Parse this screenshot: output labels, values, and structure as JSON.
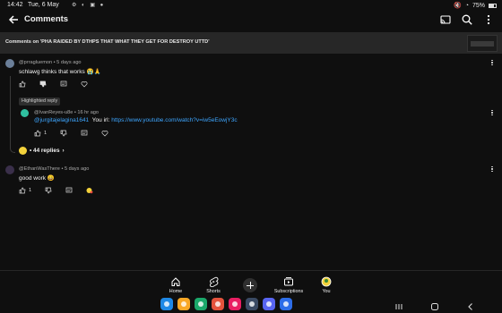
{
  "status_bar": {
    "time": "14:42",
    "date": "Tue, 6 May",
    "battery": "75%"
  },
  "app_bar": {
    "title": "Comments"
  },
  "context": {
    "text": "Comments on 'PHA RAIDED BY DTHPS THAT WHAT THEY GET FOR DESTROY UTTD'"
  },
  "comments": [
    {
      "author": "@prragluemon",
      "age": "5 days ago",
      "text": "schlawg thinks that works 😭🙏",
      "likes": ""
    },
    {
      "highlight_label": "Highlighted reply",
      "author": "@IvanReyes-u8e",
      "age": "16 hr ago",
      "mention": "@jurgitajelagina1641",
      "text_prefix": "You irl:",
      "link": "https://www.youtube.com/watch?v=iw5eEowjY3c",
      "likes": "1"
    },
    {
      "author": "@EthanWasThere",
      "age": "5 days ago",
      "text": "good work 😄",
      "likes": "1"
    }
  ],
  "replies_label": "44 replies",
  "bottom_nav": {
    "home": "Home",
    "shorts": "Shorts",
    "subscriptions": "Subscriptions",
    "you": "You"
  },
  "colors": {
    "background": "#0f0f0f",
    "link": "#3ea6ff",
    "context_bar": "#272727"
  }
}
